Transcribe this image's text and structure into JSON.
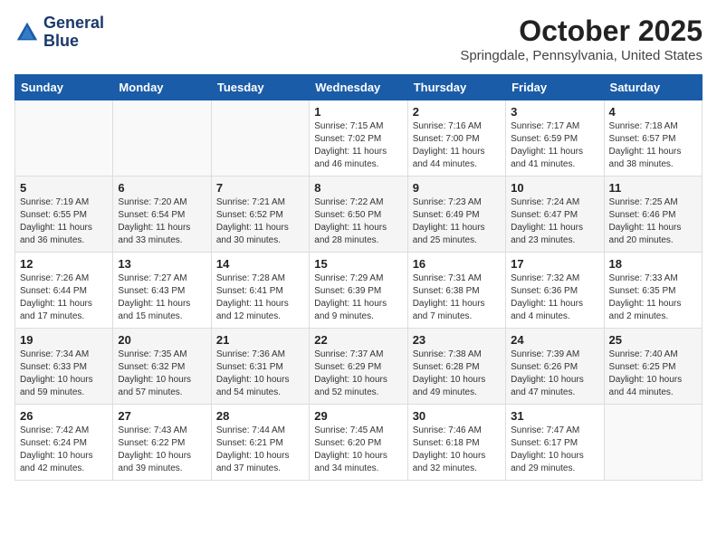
{
  "header": {
    "logo_line1": "General",
    "logo_line2": "Blue",
    "month": "October 2025",
    "location": "Springdale, Pennsylvania, United States"
  },
  "days_of_week": [
    "Sunday",
    "Monday",
    "Tuesday",
    "Wednesday",
    "Thursday",
    "Friday",
    "Saturday"
  ],
  "weeks": [
    [
      {
        "day": "",
        "info": ""
      },
      {
        "day": "",
        "info": ""
      },
      {
        "day": "",
        "info": ""
      },
      {
        "day": "1",
        "info": "Sunrise: 7:15 AM\nSunset: 7:02 PM\nDaylight: 11 hours\nand 46 minutes."
      },
      {
        "day": "2",
        "info": "Sunrise: 7:16 AM\nSunset: 7:00 PM\nDaylight: 11 hours\nand 44 minutes."
      },
      {
        "day": "3",
        "info": "Sunrise: 7:17 AM\nSunset: 6:59 PM\nDaylight: 11 hours\nand 41 minutes."
      },
      {
        "day": "4",
        "info": "Sunrise: 7:18 AM\nSunset: 6:57 PM\nDaylight: 11 hours\nand 38 minutes."
      }
    ],
    [
      {
        "day": "5",
        "info": "Sunrise: 7:19 AM\nSunset: 6:55 PM\nDaylight: 11 hours\nand 36 minutes."
      },
      {
        "day": "6",
        "info": "Sunrise: 7:20 AM\nSunset: 6:54 PM\nDaylight: 11 hours\nand 33 minutes."
      },
      {
        "day": "7",
        "info": "Sunrise: 7:21 AM\nSunset: 6:52 PM\nDaylight: 11 hours\nand 30 minutes."
      },
      {
        "day": "8",
        "info": "Sunrise: 7:22 AM\nSunset: 6:50 PM\nDaylight: 11 hours\nand 28 minutes."
      },
      {
        "day": "9",
        "info": "Sunrise: 7:23 AM\nSunset: 6:49 PM\nDaylight: 11 hours\nand 25 minutes."
      },
      {
        "day": "10",
        "info": "Sunrise: 7:24 AM\nSunset: 6:47 PM\nDaylight: 11 hours\nand 23 minutes."
      },
      {
        "day": "11",
        "info": "Sunrise: 7:25 AM\nSunset: 6:46 PM\nDaylight: 11 hours\nand 20 minutes."
      }
    ],
    [
      {
        "day": "12",
        "info": "Sunrise: 7:26 AM\nSunset: 6:44 PM\nDaylight: 11 hours\nand 17 minutes."
      },
      {
        "day": "13",
        "info": "Sunrise: 7:27 AM\nSunset: 6:43 PM\nDaylight: 11 hours\nand 15 minutes."
      },
      {
        "day": "14",
        "info": "Sunrise: 7:28 AM\nSunset: 6:41 PM\nDaylight: 11 hours\nand 12 minutes."
      },
      {
        "day": "15",
        "info": "Sunrise: 7:29 AM\nSunset: 6:39 PM\nDaylight: 11 hours\nand 9 minutes."
      },
      {
        "day": "16",
        "info": "Sunrise: 7:31 AM\nSunset: 6:38 PM\nDaylight: 11 hours\nand 7 minutes."
      },
      {
        "day": "17",
        "info": "Sunrise: 7:32 AM\nSunset: 6:36 PM\nDaylight: 11 hours\nand 4 minutes."
      },
      {
        "day": "18",
        "info": "Sunrise: 7:33 AM\nSunset: 6:35 PM\nDaylight: 11 hours\nand 2 minutes."
      }
    ],
    [
      {
        "day": "19",
        "info": "Sunrise: 7:34 AM\nSunset: 6:33 PM\nDaylight: 10 hours\nand 59 minutes."
      },
      {
        "day": "20",
        "info": "Sunrise: 7:35 AM\nSunset: 6:32 PM\nDaylight: 10 hours\nand 57 minutes."
      },
      {
        "day": "21",
        "info": "Sunrise: 7:36 AM\nSunset: 6:31 PM\nDaylight: 10 hours\nand 54 minutes."
      },
      {
        "day": "22",
        "info": "Sunrise: 7:37 AM\nSunset: 6:29 PM\nDaylight: 10 hours\nand 52 minutes."
      },
      {
        "day": "23",
        "info": "Sunrise: 7:38 AM\nSunset: 6:28 PM\nDaylight: 10 hours\nand 49 minutes."
      },
      {
        "day": "24",
        "info": "Sunrise: 7:39 AM\nSunset: 6:26 PM\nDaylight: 10 hours\nand 47 minutes."
      },
      {
        "day": "25",
        "info": "Sunrise: 7:40 AM\nSunset: 6:25 PM\nDaylight: 10 hours\nand 44 minutes."
      }
    ],
    [
      {
        "day": "26",
        "info": "Sunrise: 7:42 AM\nSunset: 6:24 PM\nDaylight: 10 hours\nand 42 minutes."
      },
      {
        "day": "27",
        "info": "Sunrise: 7:43 AM\nSunset: 6:22 PM\nDaylight: 10 hours\nand 39 minutes."
      },
      {
        "day": "28",
        "info": "Sunrise: 7:44 AM\nSunset: 6:21 PM\nDaylight: 10 hours\nand 37 minutes."
      },
      {
        "day": "29",
        "info": "Sunrise: 7:45 AM\nSunset: 6:20 PM\nDaylight: 10 hours\nand 34 minutes."
      },
      {
        "day": "30",
        "info": "Sunrise: 7:46 AM\nSunset: 6:18 PM\nDaylight: 10 hours\nand 32 minutes."
      },
      {
        "day": "31",
        "info": "Sunrise: 7:47 AM\nSunset: 6:17 PM\nDaylight: 10 hours\nand 29 minutes."
      },
      {
        "day": "",
        "info": ""
      }
    ]
  ]
}
